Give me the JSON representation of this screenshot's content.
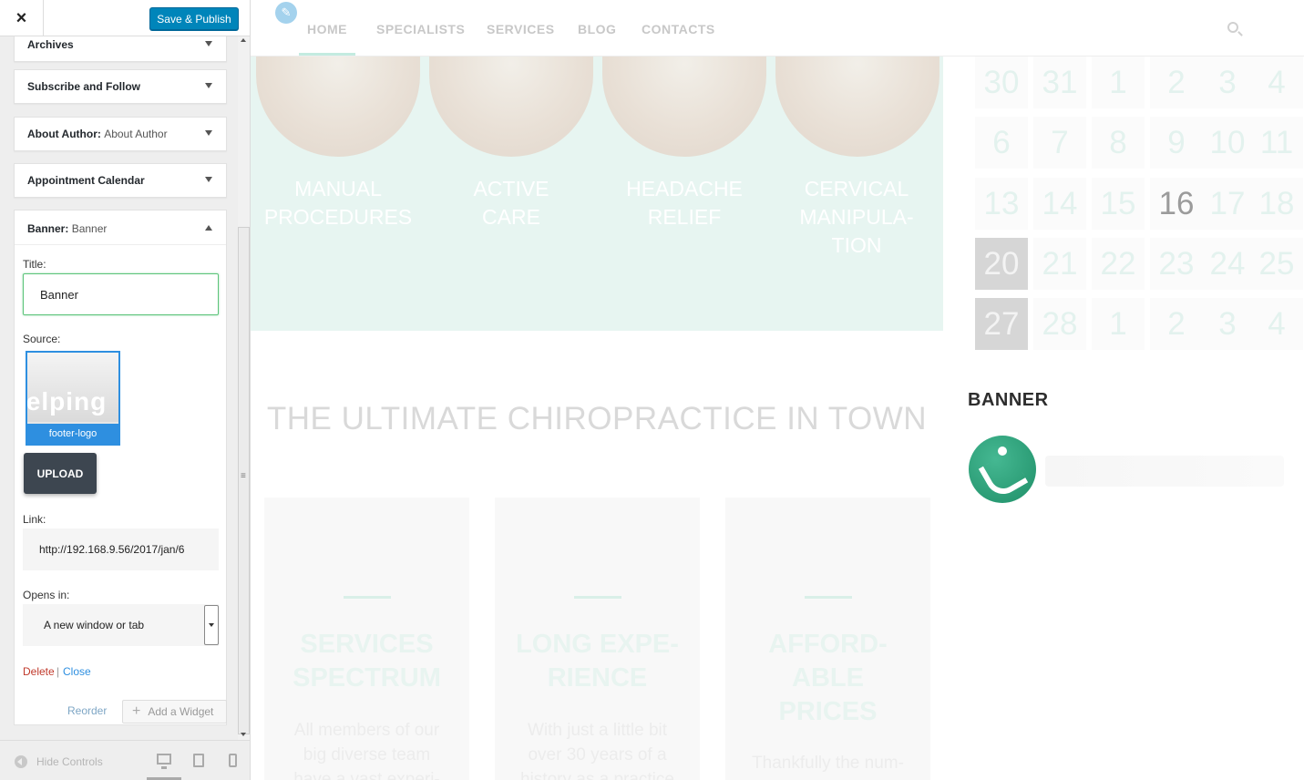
{
  "panel": {
    "close_glyph": "×",
    "save_button": "Save & Publish",
    "widgets": [
      {
        "title": "Archives",
        "subtitle": ""
      },
      {
        "title": "Subscribe and Follow",
        "subtitle": ""
      },
      {
        "title": "About Author:",
        "subtitle": "About Author"
      },
      {
        "title": "Appointment Calendar",
        "subtitle": ""
      }
    ],
    "banner_widget": {
      "title": "Banner:",
      "subtitle": "Banner",
      "title_label": "Title:",
      "title_value": "Banner",
      "source_label": "Source:",
      "source_image_text": "lelping",
      "source_caption": "footer-logo",
      "upload_button": "UPLOAD",
      "link_label": "Link:",
      "link_value": "http://192.168.9.56/2017/jan/6",
      "opens_label": "Opens in:",
      "opens_value": "A new window or tab",
      "delete_link": "Delete",
      "separator": "|",
      "close_link": "Close"
    },
    "reorder_link": "Reorder",
    "add_widget_button": "Add a Widget",
    "add_widget_plus": "+",
    "grip": "≡",
    "hide_controls": "Hide Controls"
  },
  "site": {
    "pencil": "✎",
    "nav": [
      "HOME",
      "SPECIALISTS",
      "SERVICES",
      "BLOG",
      "CONTACTS"
    ],
    "services": [
      {
        "line1": "MANUAL",
        "line2": "PROCEDURES",
        "line3": ""
      },
      {
        "line1": "ACTIVE",
        "line2": "CARE",
        "line3": ""
      },
      {
        "line1": "HEADACHE",
        "line2": "RELIEF",
        "line3": ""
      },
      {
        "line1": "CERVICAL",
        "line2": "MANIPULA-",
        "line3": "TION"
      }
    ],
    "calendar": [
      [
        "30",
        "31",
        "1",
        "2",
        "3",
        "4"
      ],
      [
        "6",
        "7",
        "8",
        "9",
        "10",
        "11"
      ],
      [
        "13",
        "14",
        "15",
        "16",
        "17",
        "18"
      ],
      [
        "20",
        "21",
        "22",
        "23",
        "24",
        "25"
      ],
      [
        "27",
        "28",
        "1",
        "2",
        "3",
        "4"
      ]
    ],
    "banner_heading": "BANNER",
    "big_heading": "THE ULTIMATE CHIROPRACTICE IN TOWN",
    "cards": [
      {
        "title": [
          "SERVICES",
          "SPECTRUM"
        ],
        "text": [
          "All members of our",
          "big diverse team",
          "have a vast experi-"
        ]
      },
      {
        "title": [
          "LONG EXPE-",
          "RIENCE"
        ],
        "text": [
          "With just a little bit",
          "over 30 years of a",
          "history as a practice"
        ]
      },
      {
        "title": [
          "AFFORD-",
          "ABLE",
          "PRICES"
        ],
        "text": [
          "Thankfully the num-"
        ]
      }
    ]
  }
}
